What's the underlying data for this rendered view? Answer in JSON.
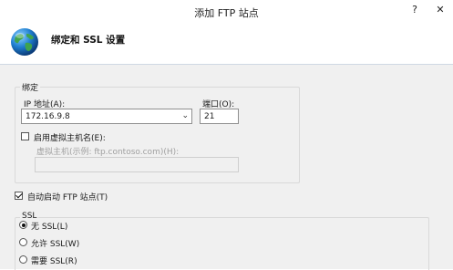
{
  "window": {
    "title": "添加 FTP 站点",
    "help_label": "?",
    "close_label": "✕"
  },
  "header": {
    "title": "绑定和 SSL 设置"
  },
  "binding": {
    "group_label": "绑定",
    "ip_label": "IP 地址(A):",
    "ip_value": "172.16.9.8",
    "port_label": "端口(O):",
    "port_value": "21",
    "virtual_host_checkbox_label": "启用虚拟主机名(E):",
    "virtual_host_checked": false,
    "virtual_host_field_label": "虚拟主机(示例: ftp.contoso.com)(H):",
    "virtual_host_value": ""
  },
  "auto_start": {
    "label": "自动启动 FTP 站点(T)",
    "checked": true
  },
  "ssl": {
    "group_label": "SSL",
    "options": [
      {
        "label": "无 SSL(L)",
        "selected": true
      },
      {
        "label": "允许 SSL(W)",
        "selected": false
      },
      {
        "label": "需要 SSL(R)",
        "selected": false
      }
    ]
  }
}
